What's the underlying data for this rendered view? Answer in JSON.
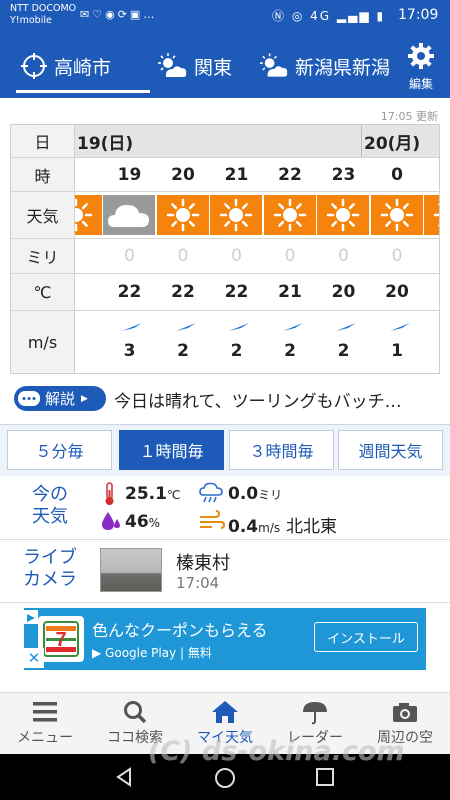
{
  "status_bar": {
    "carrier_line1": "NTT DOCOMO",
    "carrier_line2": "Y!mobile",
    "time": "17:09",
    "network": "4G"
  },
  "locations": {
    "items": [
      {
        "label": "高崎市",
        "icon": "crosshair-icon"
      },
      {
        "label": "関東",
        "icon": "sun-cloud-icon"
      },
      {
        "label": "新潟県新潟",
        "icon": "sun-cloud-icon"
      }
    ],
    "edit_label": "編集"
  },
  "forecast": {
    "updated": "17:05 更新",
    "row_labels": {
      "date": "日",
      "hour": "時",
      "weather": "天気",
      "precip": "ミリ",
      "temp": "℃",
      "wind": "m/s"
    },
    "date_left": "19(日)",
    "date_right": "20(月)",
    "hours": [
      "19",
      "20",
      "21",
      "22",
      "23",
      "0"
    ],
    "weather": [
      "cloudy",
      "sunny",
      "sunny",
      "sunny",
      "sunny",
      "sunny"
    ],
    "precip": [
      "0",
      "0",
      "0",
      "0",
      "0",
      "0"
    ],
    "temps": [
      "22",
      "22",
      "22",
      "21",
      "20",
      "20"
    ],
    "wind_speeds": [
      "3",
      "2",
      "2",
      "2",
      "2",
      "1"
    ],
    "colors": {
      "sunny": "#F5840C",
      "cloudy": "#9A9A9A",
      "wind_arrow": "#1E73D8"
    }
  },
  "commentary": {
    "badge": "解説",
    "text": "今日は晴れて、ツーリングもバッチ…"
  },
  "interval_tabs": [
    {
      "label": "５分毎",
      "active": false
    },
    {
      "label": "１時間毎",
      "active": true
    },
    {
      "label": "３時間毎",
      "active": false
    },
    {
      "label": "週間天気",
      "active": false
    }
  ],
  "current": {
    "label_line1": "今の",
    "label_line2": "天気",
    "temperature": "25.1",
    "temperature_unit": "℃",
    "rain": "0.0",
    "rain_unit": "ミリ",
    "humidity": "46",
    "humidity_unit": "%",
    "wind": "0.4",
    "wind_unit": "m/s",
    "wind_direction": "北北東"
  },
  "live_camera": {
    "label_line1": "ライブ",
    "label_line2": "カメラ",
    "place": "榛東村",
    "time": "17:04"
  },
  "ad": {
    "brand_badge": "7",
    "brand_small": "ELEVEN",
    "headline": "色んなクーポンもらえる",
    "store": "Google Play",
    "price": "無料",
    "cta": "インストール"
  },
  "bottom_nav": [
    {
      "label": "メニュー",
      "icon": "menu-icon"
    },
    {
      "label": "ココ検索",
      "icon": "search-icon"
    },
    {
      "label": "マイ天気",
      "icon": "home-icon",
      "active": true
    },
    {
      "label": "レーダー",
      "icon": "umbrella-icon"
    },
    {
      "label": "周辺の空",
      "icon": "camera-icon"
    }
  ],
  "watermark": "(C) ds-okina.com",
  "theme": {
    "primary": "#1E5BB8",
    "ad_bg": "#1F96D6"
  }
}
